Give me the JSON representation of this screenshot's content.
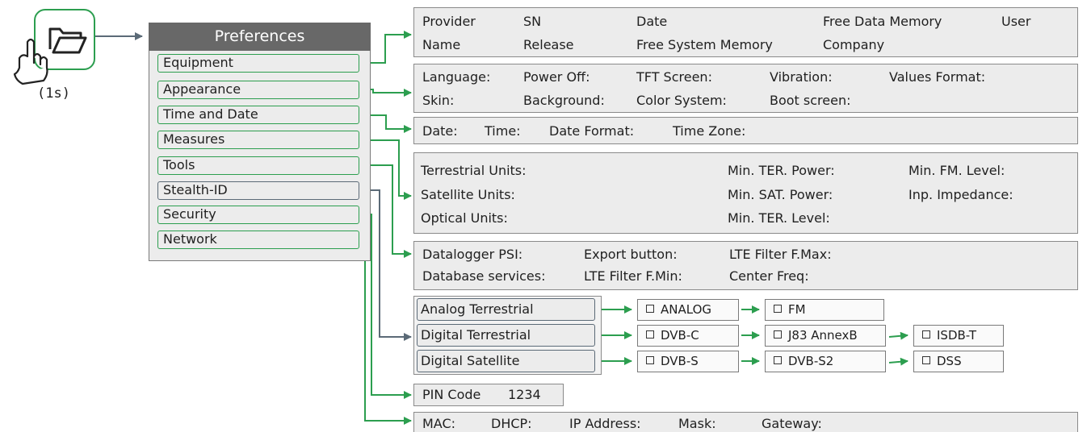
{
  "icon": {
    "name": "folder-tap-icon",
    "caption": "(1s)"
  },
  "preferences": {
    "title": "Preferences",
    "items": [
      "Equipment",
      "Appearance",
      "Time and Date",
      "Measures",
      "Tools",
      "Stealth-ID",
      "Security",
      "Network"
    ]
  },
  "equipment": {
    "row1": [
      "Provider",
      "SN",
      "Date",
      "Free Data Memory",
      "User"
    ],
    "row2": [
      "Name",
      "Release",
      "Free System Memory",
      "Company"
    ]
  },
  "appearance": {
    "row1": [
      "Language:",
      "Power Off:",
      "TFT Screen:",
      "Vibration:",
      "Values Format:"
    ],
    "row2": [
      "Skin:",
      "Background:",
      "Color System:",
      "Boot screen:"
    ]
  },
  "time_date": [
    "Date:",
    "Time:",
    "Date Format:",
    "Time Zone:"
  ],
  "measures": {
    "col1": [
      "Terrestrial Units:",
      "Satellite Units:",
      "Optical Units:"
    ],
    "col2": [
      "Min. TER. Power:",
      "Min. SAT. Power:",
      "Min. TER. Level:"
    ],
    "col3": [
      "Min. FM. Level:",
      "Inp. Impedance:"
    ]
  },
  "tools": {
    "row1": [
      "Datalogger PSI:",
      "Export button:",
      "LTE Filter F.Max:"
    ],
    "row2": [
      "Database services:",
      "LTE Filter F.Min:",
      "Center Freq:"
    ]
  },
  "stealth": {
    "analog": {
      "label": "Analog Terrestrial",
      "options": [
        "ANALOG",
        "FM"
      ]
    },
    "digital_ter": {
      "label": "Digital Terrestrial",
      "options": [
        "DVB-C",
        "J83 AnnexB",
        "ISDB-T"
      ]
    },
    "digital_sat": {
      "label": "Digital Satellite",
      "options": [
        "DVB-S",
        "DVB-S2",
        "DSS"
      ]
    }
  },
  "security": {
    "pin_label": "PIN Code",
    "pin_value": "1234"
  },
  "network": [
    "MAC:",
    "DHCP:",
    "IP Address:",
    "Mask:",
    "Gateway:"
  ],
  "colors": {
    "connector_green": "#2c9e4f",
    "connector_slate": "#5b6a77",
    "header_grey": "#686868",
    "box_fill": "#ececec"
  }
}
